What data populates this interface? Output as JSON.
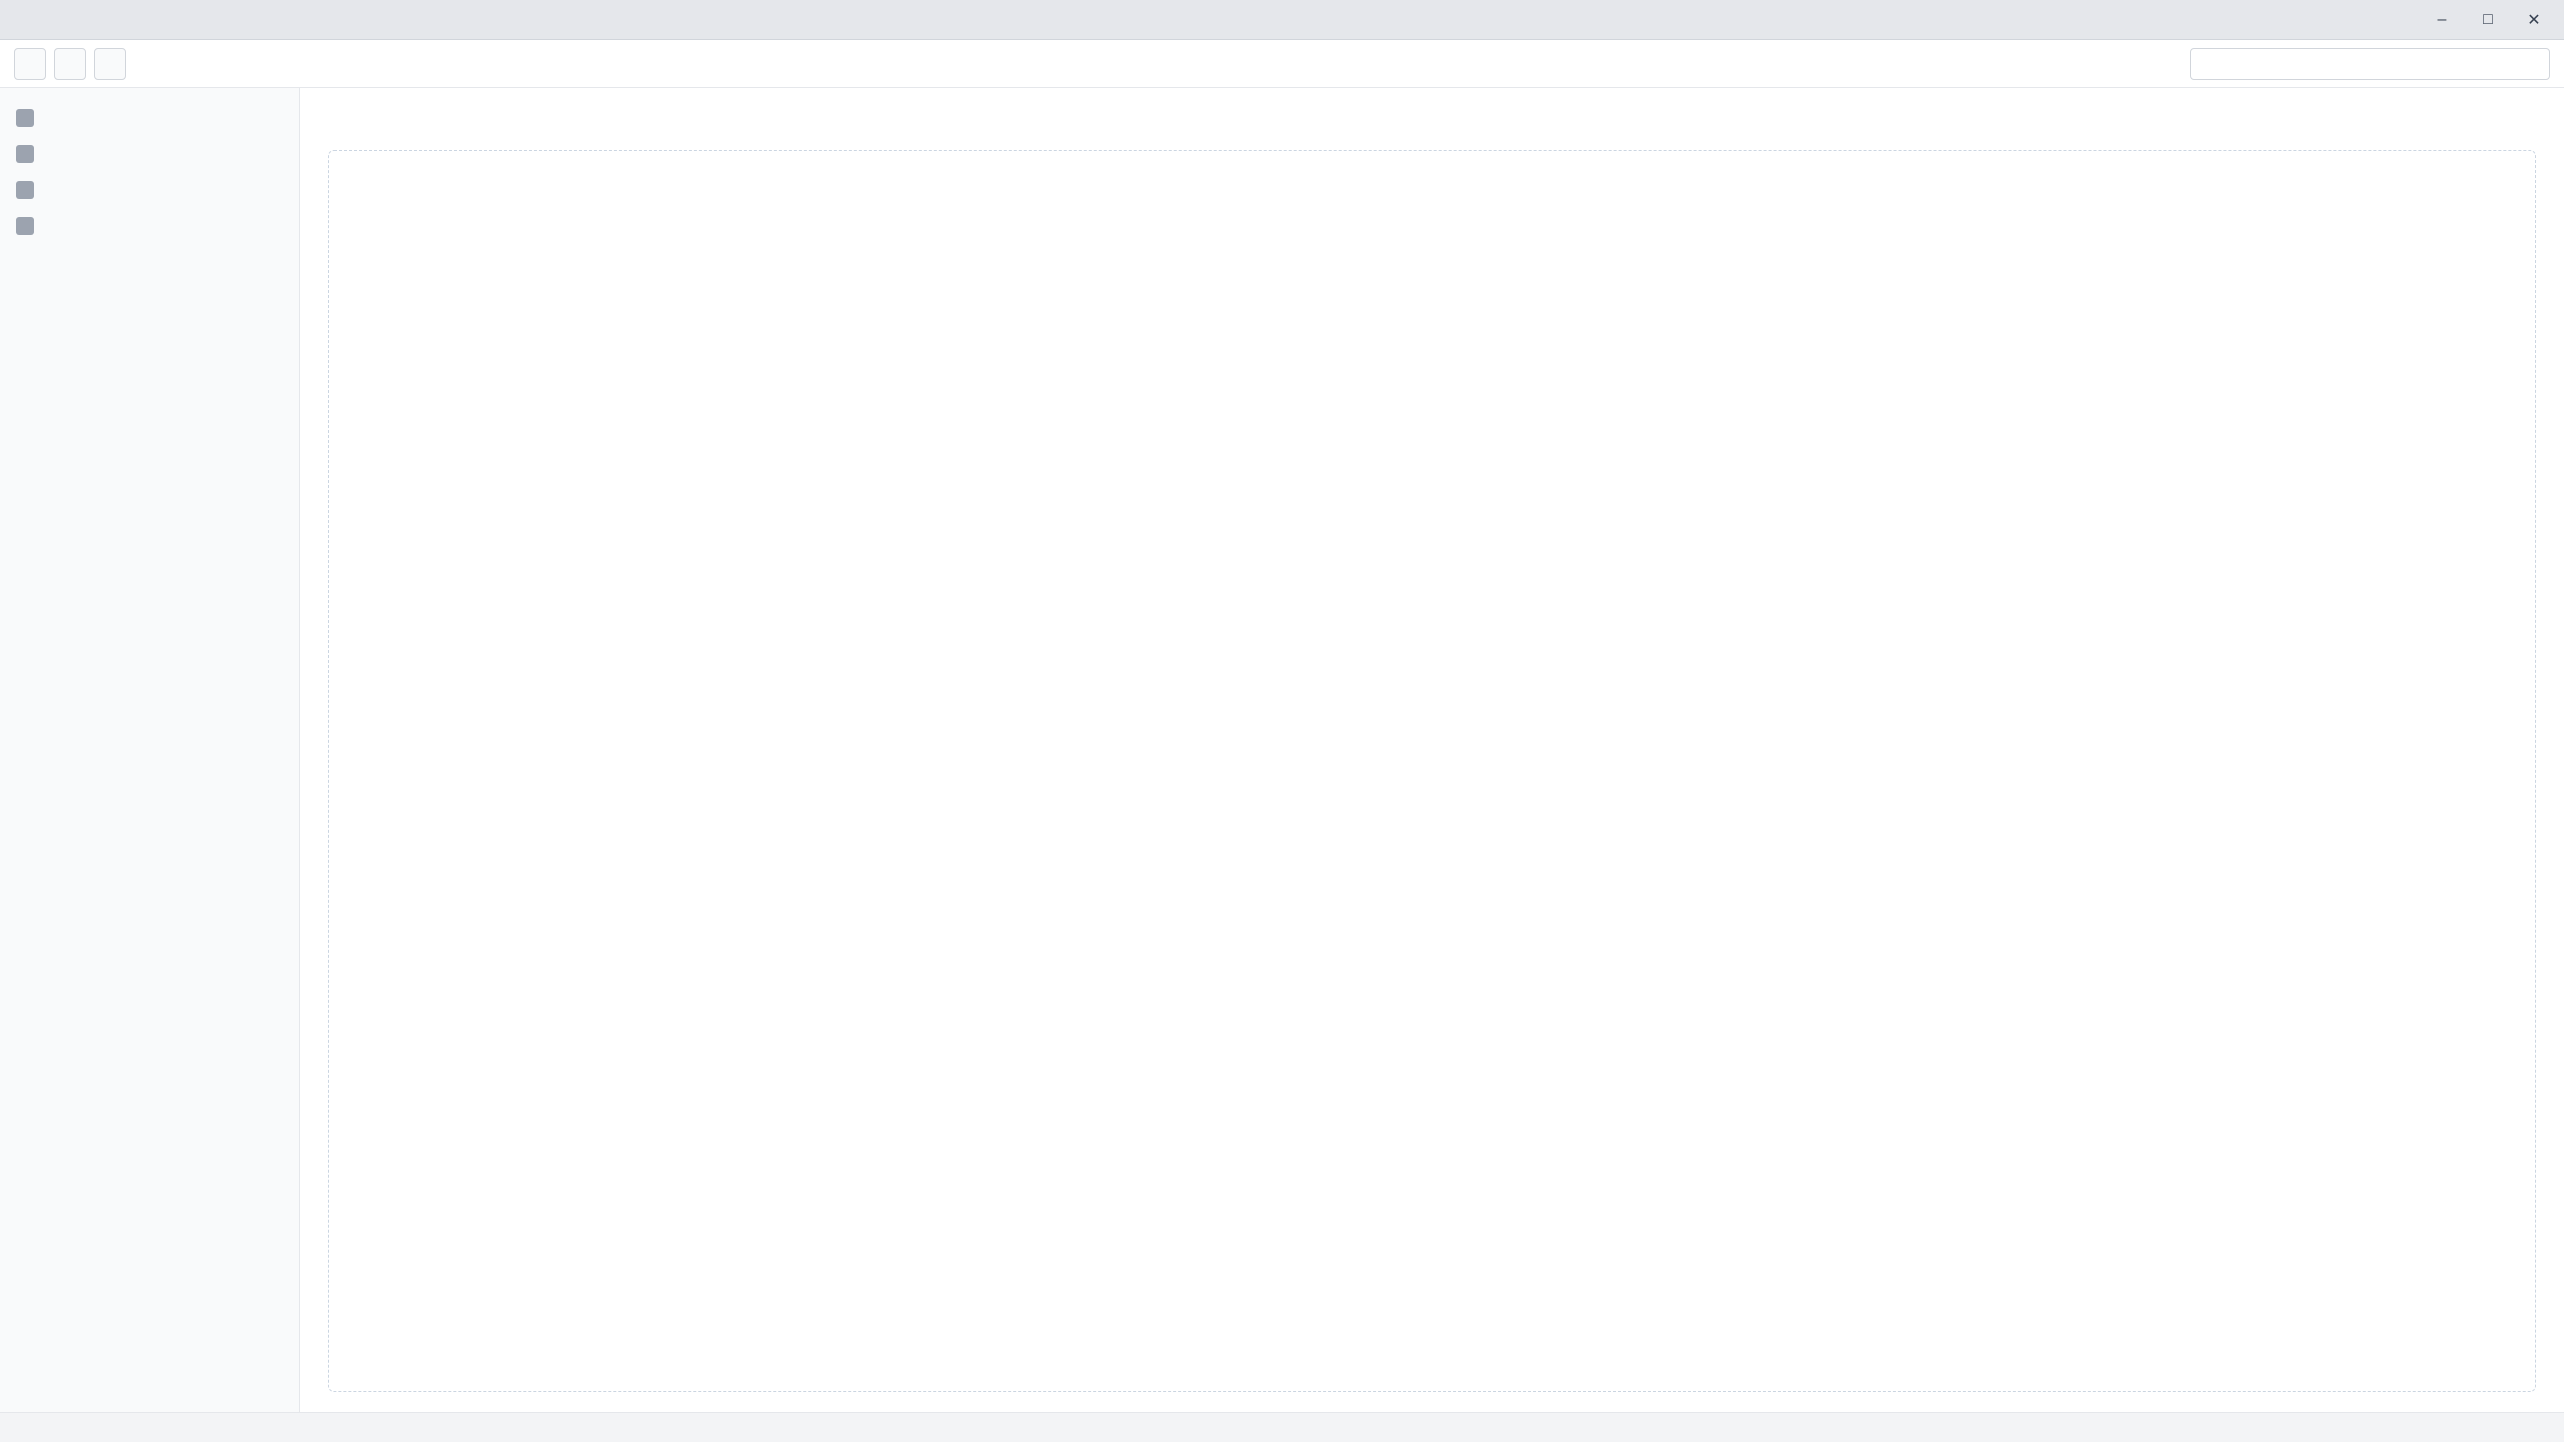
{
  "window": {
    "title": ""
  },
  "toolbar": {
    "buttons": [
      "",
      "",
      ""
    ],
    "search_placeholder": ""
  },
  "sidebar": {
    "items": [
      {
        "label": ""
      },
      {
        "label": ""
      },
      {
        "label": ""
      },
      {
        "label": ""
      }
    ]
  },
  "main": {
    "title": ""
  },
  "status": {
    "text": ""
  }
}
